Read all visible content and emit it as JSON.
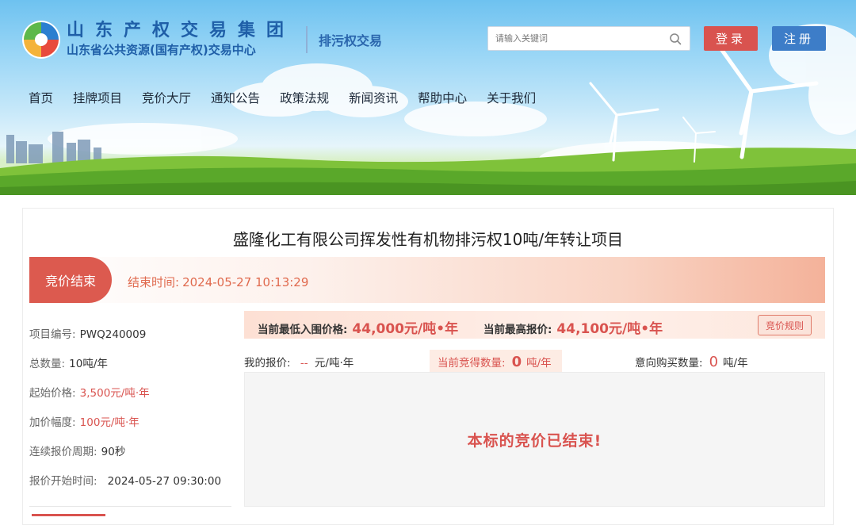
{
  "header": {
    "logo_title": "山东产权交易集团",
    "logo_subtitle": "山东省公共资源(国有产权)交易中心",
    "section_name": "排污权交易",
    "search": {
      "placeholder": "请输入关键词",
      "value": ""
    },
    "login_label": "登录",
    "register_label": "注册"
  },
  "nav": {
    "items": [
      {
        "label": "首页"
      },
      {
        "label": "挂牌项目"
      },
      {
        "label": "竞价大厅"
      },
      {
        "label": "通知公告"
      },
      {
        "label": "政策法规"
      },
      {
        "label": "新闻资讯"
      },
      {
        "label": "帮助中心"
      },
      {
        "label": "关于我们"
      }
    ]
  },
  "project": {
    "title": "盛隆化工有限公司挥发性有机物排污权10吨/年转让项目",
    "status": "竞价结束",
    "end_time_label": "结束时间:",
    "end_time": "2024-05-27 10:13:29",
    "details": {
      "code_label": "项目编号:",
      "code": "PWQ240009",
      "total_label": "总数量:",
      "total": "10吨/年",
      "start_price_label": "起始价格:",
      "start_price": "3,500元/吨·年",
      "increment_label": "加价幅度:",
      "increment": "100元/吨·年",
      "cycle_label": "连续报价周期:",
      "cycle": "90秒",
      "start_time_label": "报价开始时间:",
      "start_time": "2024-05-27 09:30:00"
    }
  },
  "bidding": {
    "min_price_label": "当前最低入围价格:",
    "min_price": "44,000元/吨•年",
    "max_price_label": "当前最高报价:",
    "max_price": "44,100元/吨•年",
    "rules_button": "竞价规则",
    "my_bid_label": "我的报价:",
    "my_bid_value": "--",
    "my_bid_unit": "元/吨·年",
    "won_label": "当前竞得数量:",
    "won_value": "0",
    "won_unit": "吨/年",
    "intent_label": "意向购买数量:",
    "intent_value": "0",
    "intent_unit": "吨/年",
    "result_message": "本标的竞价已结束!"
  },
  "colors": {
    "brand_blue": "#1f5fa8",
    "accent_red": "#d9534f",
    "register_blue": "#3d7dc8"
  }
}
